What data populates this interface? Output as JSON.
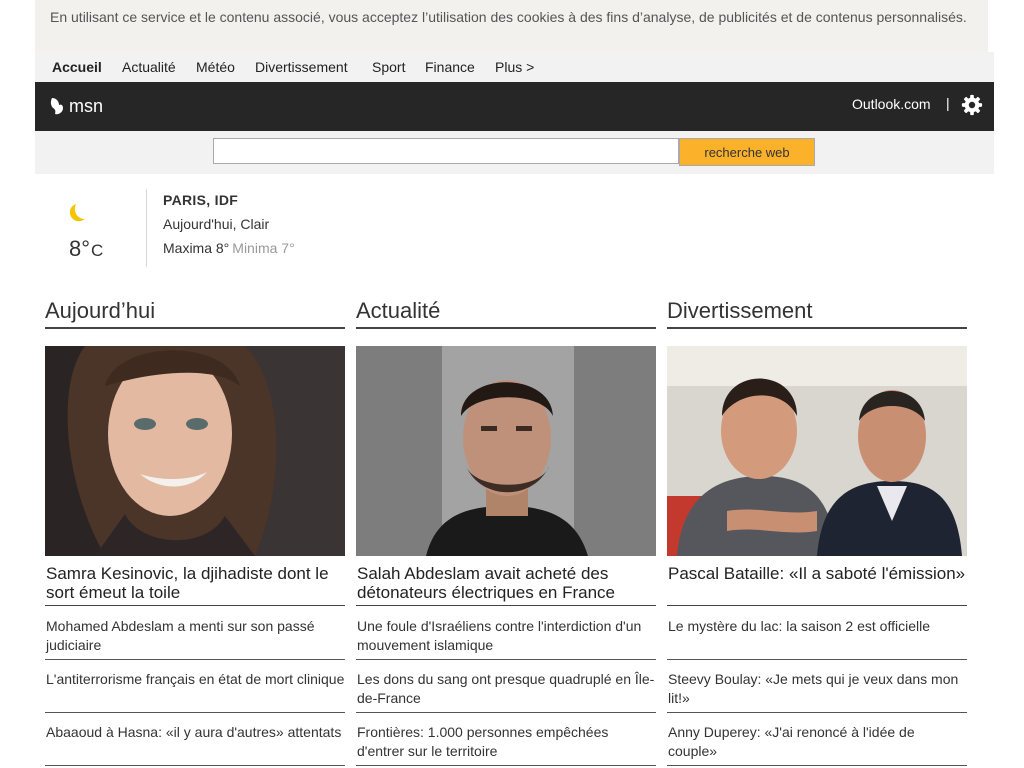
{
  "cookie_banner": {
    "text": "En utilisant ce service et le contenu associé, vous acceptez l’utilisation des cookies à des fins d’analyse, de publicités et de contenus personnalisés."
  },
  "nav": {
    "items": [
      {
        "label": "Accueil",
        "active": true
      },
      {
        "label": "Actualité"
      },
      {
        "label": "Météo"
      },
      {
        "label": "Divertissement"
      },
      {
        "label": "Sport"
      },
      {
        "label": "Finance"
      },
      {
        "label": "Plus >"
      }
    ]
  },
  "header": {
    "logo_text": "msn",
    "outlook_label": "Outlook.com",
    "separator": "|",
    "settings_icon": "gear-icon"
  },
  "search": {
    "value": "",
    "button_label": "recherche web",
    "button_color": "#fbb22a"
  },
  "weather": {
    "icon": "moon-icon",
    "temperature": "8°",
    "unit": "C",
    "city": "PARIS, IDF",
    "condition": "Aujourd'hui, Clair",
    "max": "Maxima 8°",
    "min": "Minima 7°"
  },
  "columns": [
    {
      "title": "Aujourd’hui",
      "image": "portrait-photo",
      "headline": "Samra Kesinovic, la djihadiste dont le sort émeut la toile",
      "links": [
        "Mohamed Abdeslam a menti sur son passé judiciaire",
        "L'antiterrorisme français en état de mort clinique",
        "Abaaoud à Hasna: «il y aura d'autres» attentats"
      ]
    },
    {
      "title": "Actualité",
      "image": "mugshot-photo",
      "headline": "Salah Abdeslam avait acheté des détonateurs électriques en France",
      "links": [
        "Une foule d'Israéliens contre l'interdiction d'un mouvement islamique",
        "Les dons du sang ont presque quadruplé en Île-de-France",
        "Frontières: 1.000 personnes empêchées d'entrer sur le territoire"
      ]
    },
    {
      "title": "Divertissement",
      "image": "two-men-photo",
      "headline": "Pascal Bataille: «Il a saboté l'émission»",
      "links": [
        "Le mystère du lac: la saison 2 est officielle",
        "Steevy Boulay: «Je mets qui je veux dans mon lit!»",
        "Anny Duperey: «J'ai renoncé à l'idée de couple»"
      ]
    }
  ]
}
